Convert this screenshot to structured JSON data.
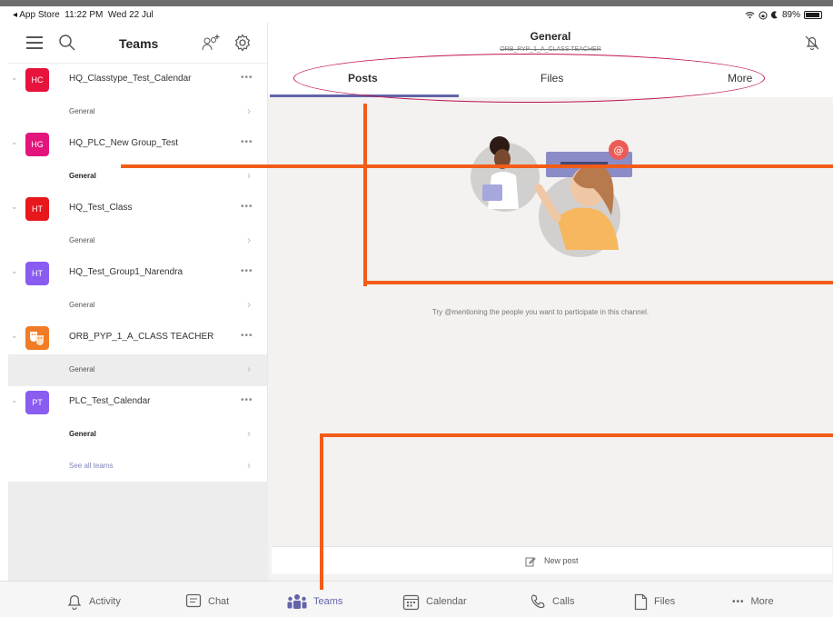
{
  "status_bar": {
    "back_app": "◂ App Store",
    "time": "11:22 PM",
    "date": "Wed 22 Jul",
    "battery": "89%",
    "battery_level": 0.89
  },
  "sidebar": {
    "title": "Teams",
    "teams": [
      {
        "initials": "HC",
        "name": "HQ_Classtype_Test_Calendar",
        "color": "#e8133d",
        "channel": "General",
        "channel_bold": false,
        "selected": false
      },
      {
        "initials": "HG",
        "name": "HQ_PLC_New Group_Test",
        "color": "#e3157d",
        "channel": "General",
        "channel_bold": true,
        "selected": false
      },
      {
        "initials": "HT",
        "name": "HQ_Test_Class",
        "color": "#e8171c",
        "channel": "General",
        "channel_bold": false,
        "selected": false
      },
      {
        "initials": "HT",
        "name": "HQ_Test_Group1_Narendra",
        "color": "#8a5cf0",
        "channel": "General",
        "channel_bold": false,
        "selected": false
      },
      {
        "initials": "",
        "name": "ORB_PYP_1_A_CLASS TEACHER",
        "color": "#f07c25",
        "channel": "General",
        "channel_bold": false,
        "selected": true
      },
      {
        "initials": "PT",
        "name": "PLC_Test_Calendar",
        "color": "#8a5cf0",
        "channel": "General",
        "channel_bold": true,
        "selected": false
      }
    ],
    "see_all": "See all teams",
    "more_dots": "•••"
  },
  "main": {
    "channel_title": "General",
    "channel_subtitle": "ORB_PYP_1_A_CLASS TEACHER",
    "tabs": [
      {
        "label": "Posts",
        "active": true
      },
      {
        "label": "Files",
        "active": false
      },
      {
        "label": "More",
        "active": false
      }
    ],
    "empty_message": "Try @mentioning the people you want to participate in this channel.",
    "new_post": "New post",
    "accent": "#6264a7"
  },
  "bottom_nav": {
    "items": [
      {
        "label": "Activity",
        "icon": "bell-icon",
        "active": false
      },
      {
        "label": "Chat",
        "icon": "chat-icon",
        "active": false
      },
      {
        "label": "Teams",
        "icon": "teams-icon",
        "active": true
      },
      {
        "label": "Calendar",
        "icon": "calendar-icon",
        "active": false
      },
      {
        "label": "Calls",
        "icon": "phone-icon",
        "active": false
      },
      {
        "label": "Files",
        "icon": "file-icon",
        "active": false
      },
      {
        "label": "More",
        "icon": "more-dots-icon",
        "active": false
      }
    ],
    "more_glyph": "•••"
  },
  "annotation_colors": {
    "ellipse": "#c0124f",
    "lines": "#f25c19"
  }
}
